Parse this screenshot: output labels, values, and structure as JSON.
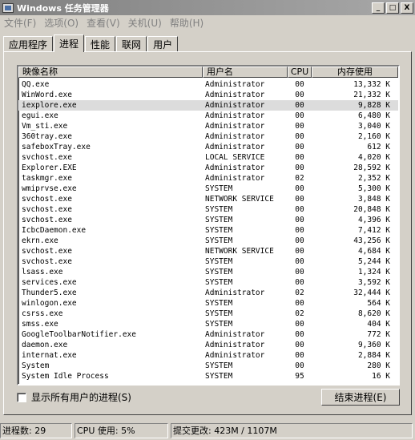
{
  "window": {
    "title": "Windows 任务管理器",
    "buttons": [
      "_",
      "□",
      "X"
    ]
  },
  "menu": [
    "文件(F)",
    "选项(O)",
    "查看(V)",
    "关机(U)",
    "帮助(H)"
  ],
  "tabs": [
    "应用程序",
    "进程",
    "性能",
    "联网",
    "用户"
  ],
  "active_tab": "进程",
  "columns": {
    "name": "映像名称",
    "user": "用户名",
    "cpu": "CPU",
    "mem": "内存使用"
  },
  "processes": [
    {
      "name": "QQ.exe",
      "user": "Administrator",
      "cpu": "00",
      "mem": "13,332 K"
    },
    {
      "name": "WinWord.exe",
      "user": "Administrator",
      "cpu": "00",
      "mem": "21,332 K"
    },
    {
      "name": "iexplore.exe",
      "user": "Administrator",
      "cpu": "00",
      "mem": "9,828 K"
    },
    {
      "name": "egui.exe",
      "user": "Administrator",
      "cpu": "00",
      "mem": "6,480 K"
    },
    {
      "name": "Vm_sti.exe",
      "user": "Administrator",
      "cpu": "00",
      "mem": "3,040 K"
    },
    {
      "name": "360tray.exe",
      "user": "Administrator",
      "cpu": "00",
      "mem": "2,160 K"
    },
    {
      "name": "safeboxTray.exe",
      "user": "Administrator",
      "cpu": "00",
      "mem": "612 K"
    },
    {
      "name": "svchost.exe",
      "user": "LOCAL SERVICE",
      "cpu": "00",
      "mem": "4,020 K"
    },
    {
      "name": "Explorer.EXE",
      "user": "Administrator",
      "cpu": "00",
      "mem": "28,592 K"
    },
    {
      "name": "taskmgr.exe",
      "user": "Administrator",
      "cpu": "02",
      "mem": "2,352 K"
    },
    {
      "name": "wmiprvse.exe",
      "user": "SYSTEM",
      "cpu": "00",
      "mem": "5,300 K"
    },
    {
      "name": "svchost.exe",
      "user": "NETWORK SERVICE",
      "cpu": "00",
      "mem": "3,848 K"
    },
    {
      "name": "svchost.exe",
      "user": "SYSTEM",
      "cpu": "00",
      "mem": "20,848 K"
    },
    {
      "name": "svchost.exe",
      "user": "SYSTEM",
      "cpu": "00",
      "mem": "4,396 K"
    },
    {
      "name": "IcbcDaemon.exe",
      "user": "SYSTEM",
      "cpu": "00",
      "mem": "7,412 K"
    },
    {
      "name": "ekrn.exe",
      "user": "SYSTEM",
      "cpu": "00",
      "mem": "43,256 K"
    },
    {
      "name": "svchost.exe",
      "user": "NETWORK SERVICE",
      "cpu": "00",
      "mem": "4,684 K"
    },
    {
      "name": "svchost.exe",
      "user": "SYSTEM",
      "cpu": "00",
      "mem": "5,244 K"
    },
    {
      "name": "lsass.exe",
      "user": "SYSTEM",
      "cpu": "00",
      "mem": "1,324 K"
    },
    {
      "name": "services.exe",
      "user": "SYSTEM",
      "cpu": "00",
      "mem": "3,592 K"
    },
    {
      "name": "Thunder5.exe",
      "user": "Administrator",
      "cpu": "02",
      "mem": "32,444 K"
    },
    {
      "name": "winlogon.exe",
      "user": "SYSTEM",
      "cpu": "00",
      "mem": "564 K"
    },
    {
      "name": "csrss.exe",
      "user": "SYSTEM",
      "cpu": "02",
      "mem": "8,620 K"
    },
    {
      "name": "smss.exe",
      "user": "SYSTEM",
      "cpu": "00",
      "mem": "404 K"
    },
    {
      "name": "GoogleToolbarNotifier.exe",
      "user": "Administrator",
      "cpu": "00",
      "mem": "772 K"
    },
    {
      "name": "daemon.exe",
      "user": "Administrator",
      "cpu": "00",
      "mem": "9,360 K"
    },
    {
      "name": "internat.exe",
      "user": "Administrator",
      "cpu": "00",
      "mem": "2,884 K"
    },
    {
      "name": "System",
      "user": "SYSTEM",
      "cpu": "00",
      "mem": "280 K"
    },
    {
      "name": "System Idle Process",
      "user": "SYSTEM",
      "cpu": "95",
      "mem": "16 K"
    }
  ],
  "selected_process": "iexplore.exe",
  "show_all_label": "显示所有用户的进程(S)",
  "end_process_label": "结束进程(E)",
  "status": {
    "processes": "进程数: 29",
    "cpu": "CPU 使用: 5%",
    "commit": "提交更改: 423M / 1107M"
  }
}
